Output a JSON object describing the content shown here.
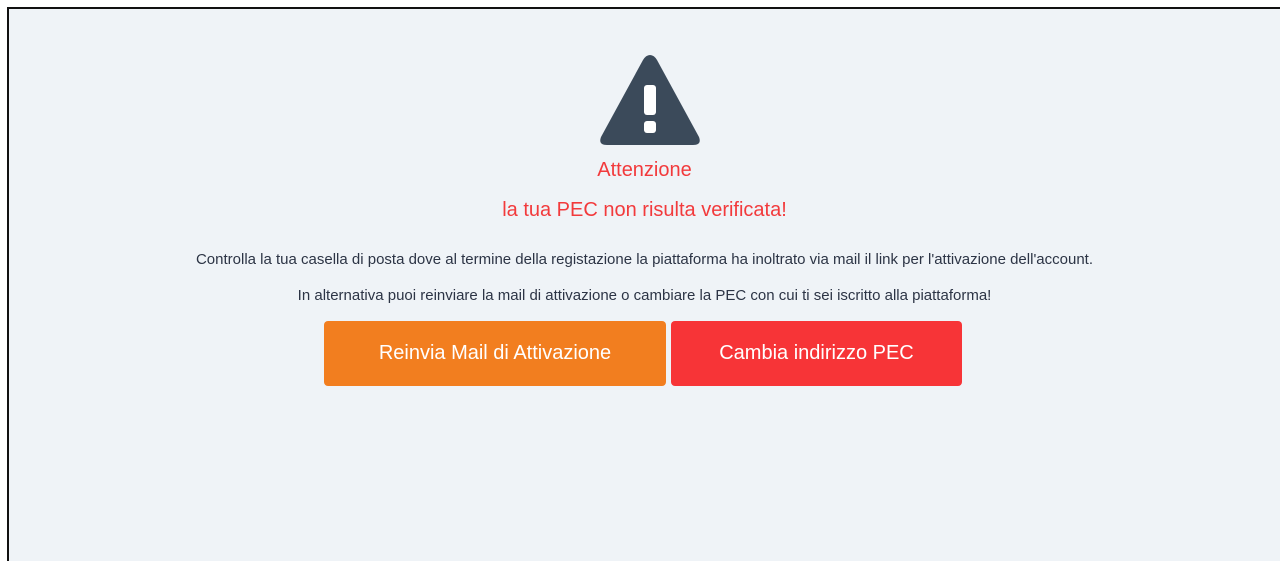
{
  "alert": {
    "icon": "warning-icon",
    "icon_color": "#3b4a5a",
    "title": "Attenzione",
    "subtitle": "la tua PEC non risulta verificata!",
    "message_line_1": "Controlla la tua casella di posta dove al termine della registazione la piattaforma ha inoltrato via mail il link per l'attivazione dell'account.",
    "message_line_2": "In alternativa puoi reinviare la mail di attivazione o cambiare la PEC con cui ti sei iscritto alla piattaforma!",
    "accent_color": "#f23a3c"
  },
  "actions": {
    "resend_label": "Reinvia Mail di Attivazione",
    "resend_color": "#f27e1f",
    "change_label": "Cambia indirizzo PEC",
    "change_color": "#f73437"
  }
}
